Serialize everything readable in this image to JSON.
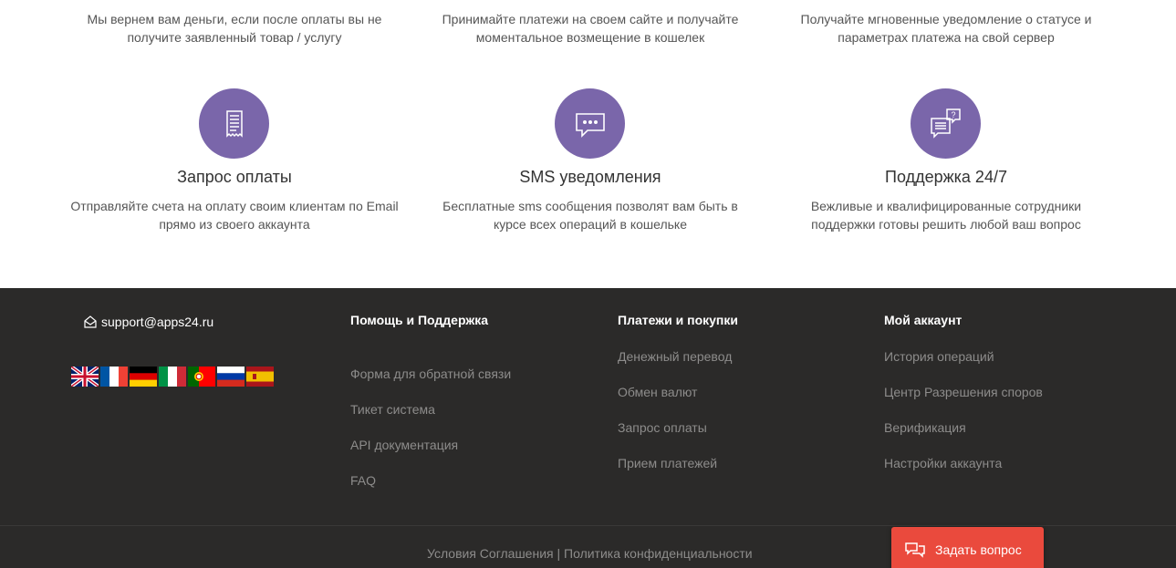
{
  "features": {
    "top": [
      {
        "text1": "Мы вернем вам деньги, если после оплаты вы не",
        "text2": "получите заявленный товар / услугу"
      },
      {
        "text1": "Принимайте платежи на своем сайте и получайте",
        "text2": "моментальное возмещение в кошелек"
      },
      {
        "text1": "Получайте мгновенные уведомление о статусе и",
        "text2": "параметрах платежа на свой сервер"
      }
    ],
    "items": [
      {
        "icon": "receipt-icon",
        "title": "Запрос оплаты",
        "text1": "Отправляйте счета на оплату своим клиентам по Email",
        "text2": "прямо из своего аккаунта"
      },
      {
        "icon": "chat-bubble-icon",
        "title": "SMS уведомления",
        "text1": "Бесплатные sms сообщения позволят вам быть в",
        "text2": "курсе всех операций в кошельке"
      },
      {
        "icon": "support-question-icon",
        "title": "Поддержка 24/7",
        "text1": "Вежливые и квалифицированные сотрудники",
        "text2": "поддержки готовы решить любой ваш вопрос"
      }
    ],
    "accent_color": "#7a66aa"
  },
  "footer": {
    "email": "support@apps24.ru",
    "languages": [
      "en",
      "fr",
      "de",
      "it",
      "pt",
      "ru",
      "es"
    ],
    "col1": {
      "title": "Помощь и Поддержка",
      "links": [
        "Форма для обратной связи",
        "Тикет система",
        "API документация",
        "FAQ"
      ]
    },
    "col2": {
      "title": "Платежи и покупки",
      "links": [
        "Денежный перевод",
        "Обмен валют",
        "Запрос оплаты",
        "Прием платежей"
      ]
    },
    "col3": {
      "title": "Мой аккаунт",
      "links": [
        "История операций",
        "Центр Разрешения споров",
        "Верификация",
        "Настройки аккаунта"
      ]
    },
    "terms": "Условия Соглашения",
    "separator": "|",
    "privacy": "Политика конфиденциальности",
    "background": "#2b2a29"
  },
  "ask_button": {
    "label": "Задать вопрос",
    "color": "#ea4a3d"
  }
}
